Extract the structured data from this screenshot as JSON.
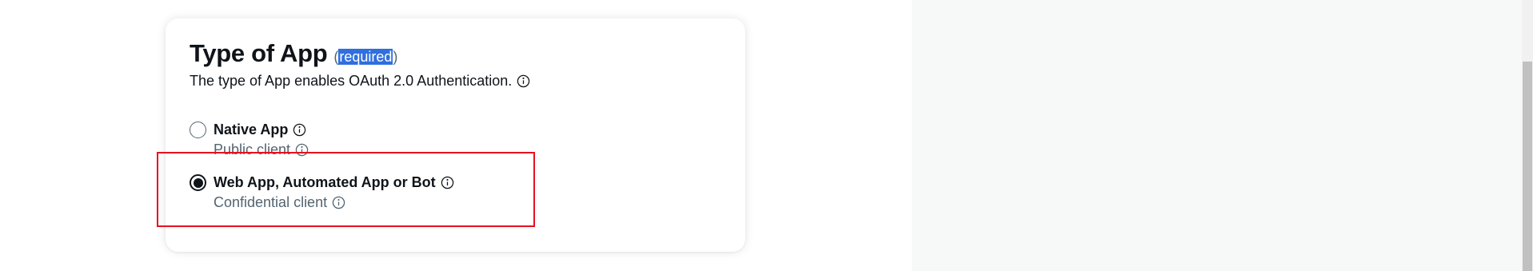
{
  "section": {
    "title": "Type of App",
    "required_label": "required",
    "description": "The type of App enables OAuth 2.0 Authentication."
  },
  "options": [
    {
      "label": "Native App",
      "description": "Public client",
      "selected": false
    },
    {
      "label": "Web App, Automated App or Bot",
      "description": "Confidential client",
      "selected": true
    }
  ],
  "icons": {
    "info": "info-circle-icon"
  },
  "colors": {
    "text_primary": "#0f1419",
    "text_secondary": "#536471",
    "selection_highlight": "#2f6fde",
    "annotation_box": "#e8101f",
    "side_panel": "#f7f8f8"
  }
}
